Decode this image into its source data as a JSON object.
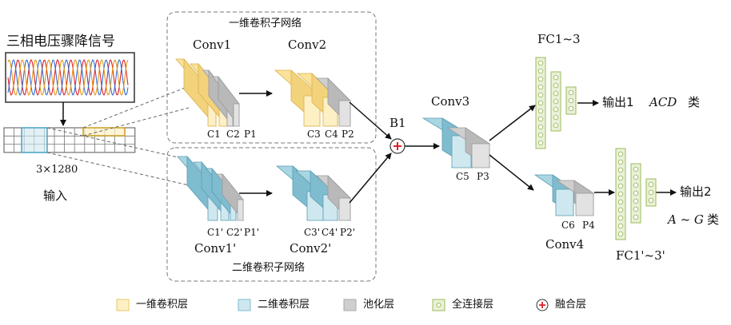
{
  "input": {
    "title": "三相电压骤降信号",
    "size": "3×1280",
    "label": "输入"
  },
  "groups": {
    "one_d": "一维卷积子网络",
    "two_d": "二维卷积子网络"
  },
  "blocks": {
    "conv1": "Conv1",
    "conv2": "Conv2",
    "conv1p": "Conv1'",
    "conv2p": "Conv2'",
    "conv3": "Conv3",
    "conv4": "Conv4",
    "b1": "B1"
  },
  "small_labels": {
    "c1": "C1",
    "c2": "C2",
    "p1": "P1",
    "c3": "C3",
    "c4": "C4",
    "p2": "P2",
    "c1p": "C1'",
    "c2p": "C2'",
    "p1p": "P1'",
    "c3p": "C3'",
    "c4p": "C4'",
    "p2p": "P2'",
    "c5": "C5",
    "p3": "P3",
    "c6": "C6",
    "p4": "P4"
  },
  "fc": {
    "fc1": "FC1~3",
    "fc2": "FC1'~3'"
  },
  "outputs": {
    "out1_text": "输出1",
    "out1_cls": "ACD",
    "out1_suffix": "类",
    "out2_text": "输出2",
    "out2_cls": "A ~ G",
    "out2_suffix": "类"
  },
  "legend": {
    "conv1d": "一维卷积层",
    "conv2d": "二维卷积层",
    "pool": "池化层",
    "fc": "全连接层",
    "fusion": "融合层"
  },
  "colors": {
    "yellow_front": "#fdf0c4",
    "yellow_side": "#f3d27c",
    "yellow_top": "#fbe29a",
    "blue_front": "#cfe8f0",
    "blue_side": "#7fbccf",
    "blue_top": "#a9d6e3",
    "gray_front": "#e2e2e2",
    "gray_side": "#b9b9b9",
    "gray_top": "#cfcfcf",
    "fc_fill": "#e9f1d8",
    "fc_stroke": "#9bbb59",
    "fusion_red": "#e0202a"
  }
}
